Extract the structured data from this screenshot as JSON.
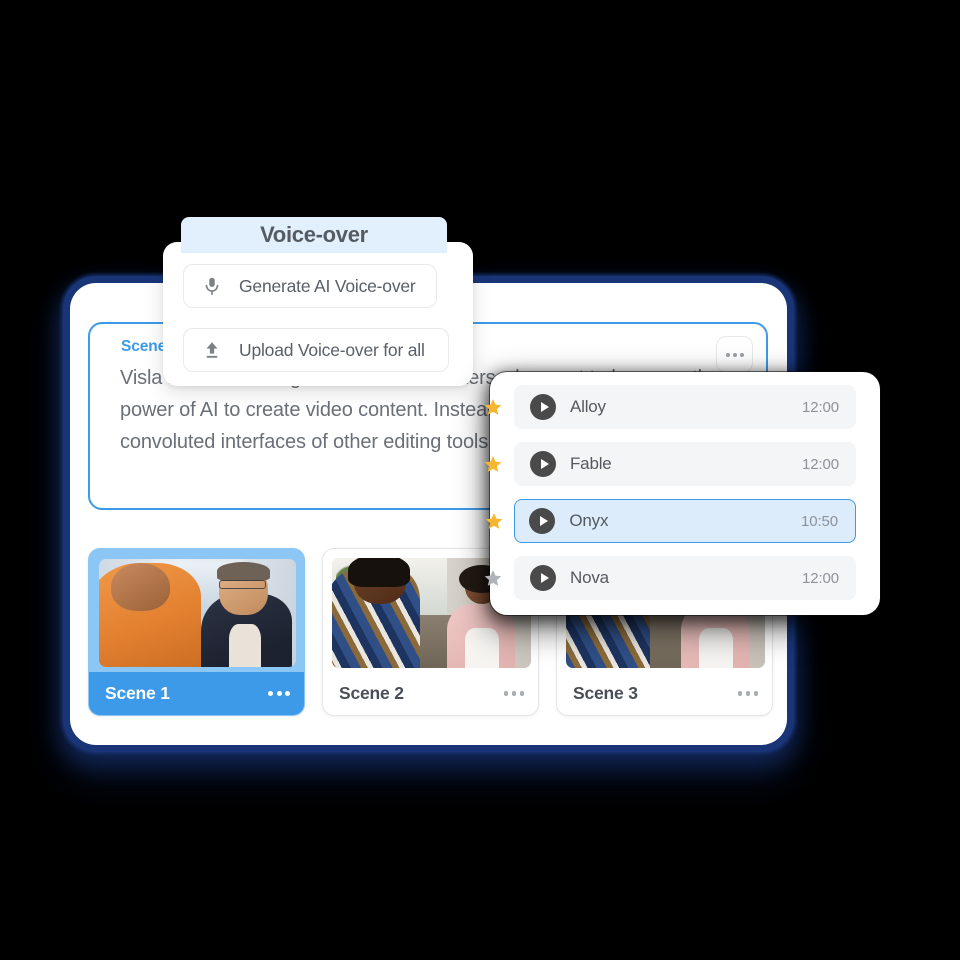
{
  "theme": {
    "background": "#000000",
    "accent_blue": "#3d9ae8",
    "selected_row_fill": "#dcecfb",
    "header_fill": "#e2effc",
    "star_active": "#f5b731",
    "star_inactive": "#b0b4b8",
    "window_shadow_navy": "#1a3678",
    "text_muted": "#6b7078"
  },
  "scene_editor": {
    "title": "Scene 1",
    "body": "Visla is an AI video generator for marketers who want to leverage the power of AI to create video content. Instead of spending hours in the convoluted interfaces of other editing tools",
    "more_menu_label": "..."
  },
  "voice_over_popup": {
    "header_title": "Voice-over",
    "options": [
      {
        "label": "Generate AI Voice-over",
        "icon": "microphone-icon"
      },
      {
        "label": "Upload Voice-over for all",
        "icon": "upload-icon"
      }
    ]
  },
  "voice_panel": {
    "voices": [
      {
        "name": "Alloy",
        "duration": "12:00",
        "starred": true,
        "selected": false
      },
      {
        "name": "Fable",
        "duration": "12:00",
        "starred": true,
        "selected": false
      },
      {
        "name": "Onyx",
        "duration": "10:50",
        "starred": true,
        "selected": true
      },
      {
        "name": "Nova",
        "duration": "12:00",
        "starred": false,
        "selected": false
      }
    ]
  },
  "scene_strip": {
    "scenes": [
      {
        "label": "Scene 1",
        "selected": true,
        "menu_label": "..."
      },
      {
        "label": "Scene 2",
        "selected": false,
        "menu_label": "..."
      },
      {
        "label": "Scene 3",
        "selected": false,
        "menu_label": "..."
      }
    ]
  }
}
